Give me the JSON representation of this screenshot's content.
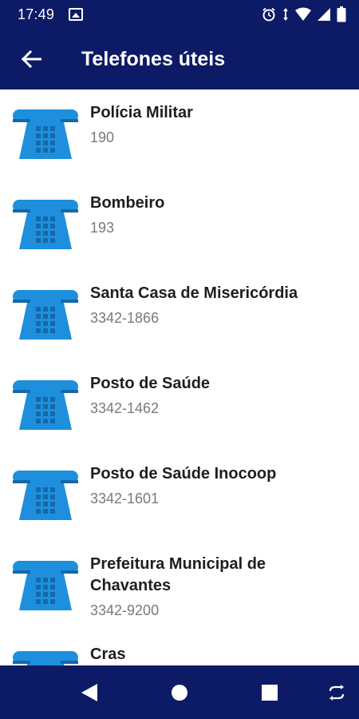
{
  "status_bar": {
    "time": "17:49",
    "icons": [
      "image-icon",
      "alarm-icon",
      "data-arrows-icon",
      "wifi-icon",
      "signal-icon",
      "battery-icon"
    ]
  },
  "app_bar": {
    "title": "Telefones úteis",
    "back_icon": "back-arrow-icon"
  },
  "colors": {
    "primary": "#0d1a66",
    "phone_icon": "#1e8fdc",
    "phone_icon_dark": "#1668a8",
    "name_text": "#1e1e1e",
    "number_text": "#7a7a7a"
  },
  "contacts": [
    {
      "name": "Polícia Militar",
      "number": "190"
    },
    {
      "name": "Bombeiro",
      "number": "193"
    },
    {
      "name": "Santa Casa de Misericórdia",
      "number": "3342-1866"
    },
    {
      "name": "Posto de Saúde",
      "number": "3342-1462"
    },
    {
      "name": "Posto de Saúde Inocoop",
      "number": "3342-1601"
    },
    {
      "name": "Prefeitura Municipal de Chavantes",
      "number": "3342-9200"
    },
    {
      "name": "Cras",
      "number": ""
    }
  ],
  "nav_bar": {
    "icons": [
      "back-triangle-icon",
      "home-circle-icon",
      "recents-square-icon",
      "rotate-icon"
    ]
  }
}
